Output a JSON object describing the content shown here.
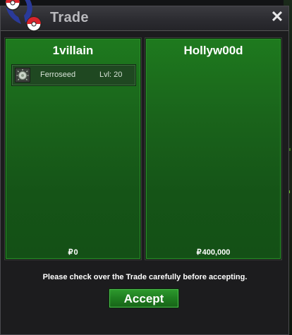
{
  "window": {
    "title": "Trade",
    "close_label": "✕"
  },
  "trade": {
    "left": {
      "player_name": "1villain",
      "money": "0",
      "items": [
        {
          "name": "Ferroseed",
          "level": "Lvl: 20",
          "icon": "ferroseed-icon"
        }
      ]
    },
    "right": {
      "player_name": "Hollyw00d",
      "money": "400,000",
      "items": []
    },
    "currency_symbol": "₽"
  },
  "notice": "Please check over the Trade carefully before accepting.",
  "buttons": {
    "accept_label": "Accept"
  },
  "colors": {
    "panel_green": "#1a641b",
    "accept_green": "#1f7d20",
    "titlebar": "#2c2c31"
  }
}
